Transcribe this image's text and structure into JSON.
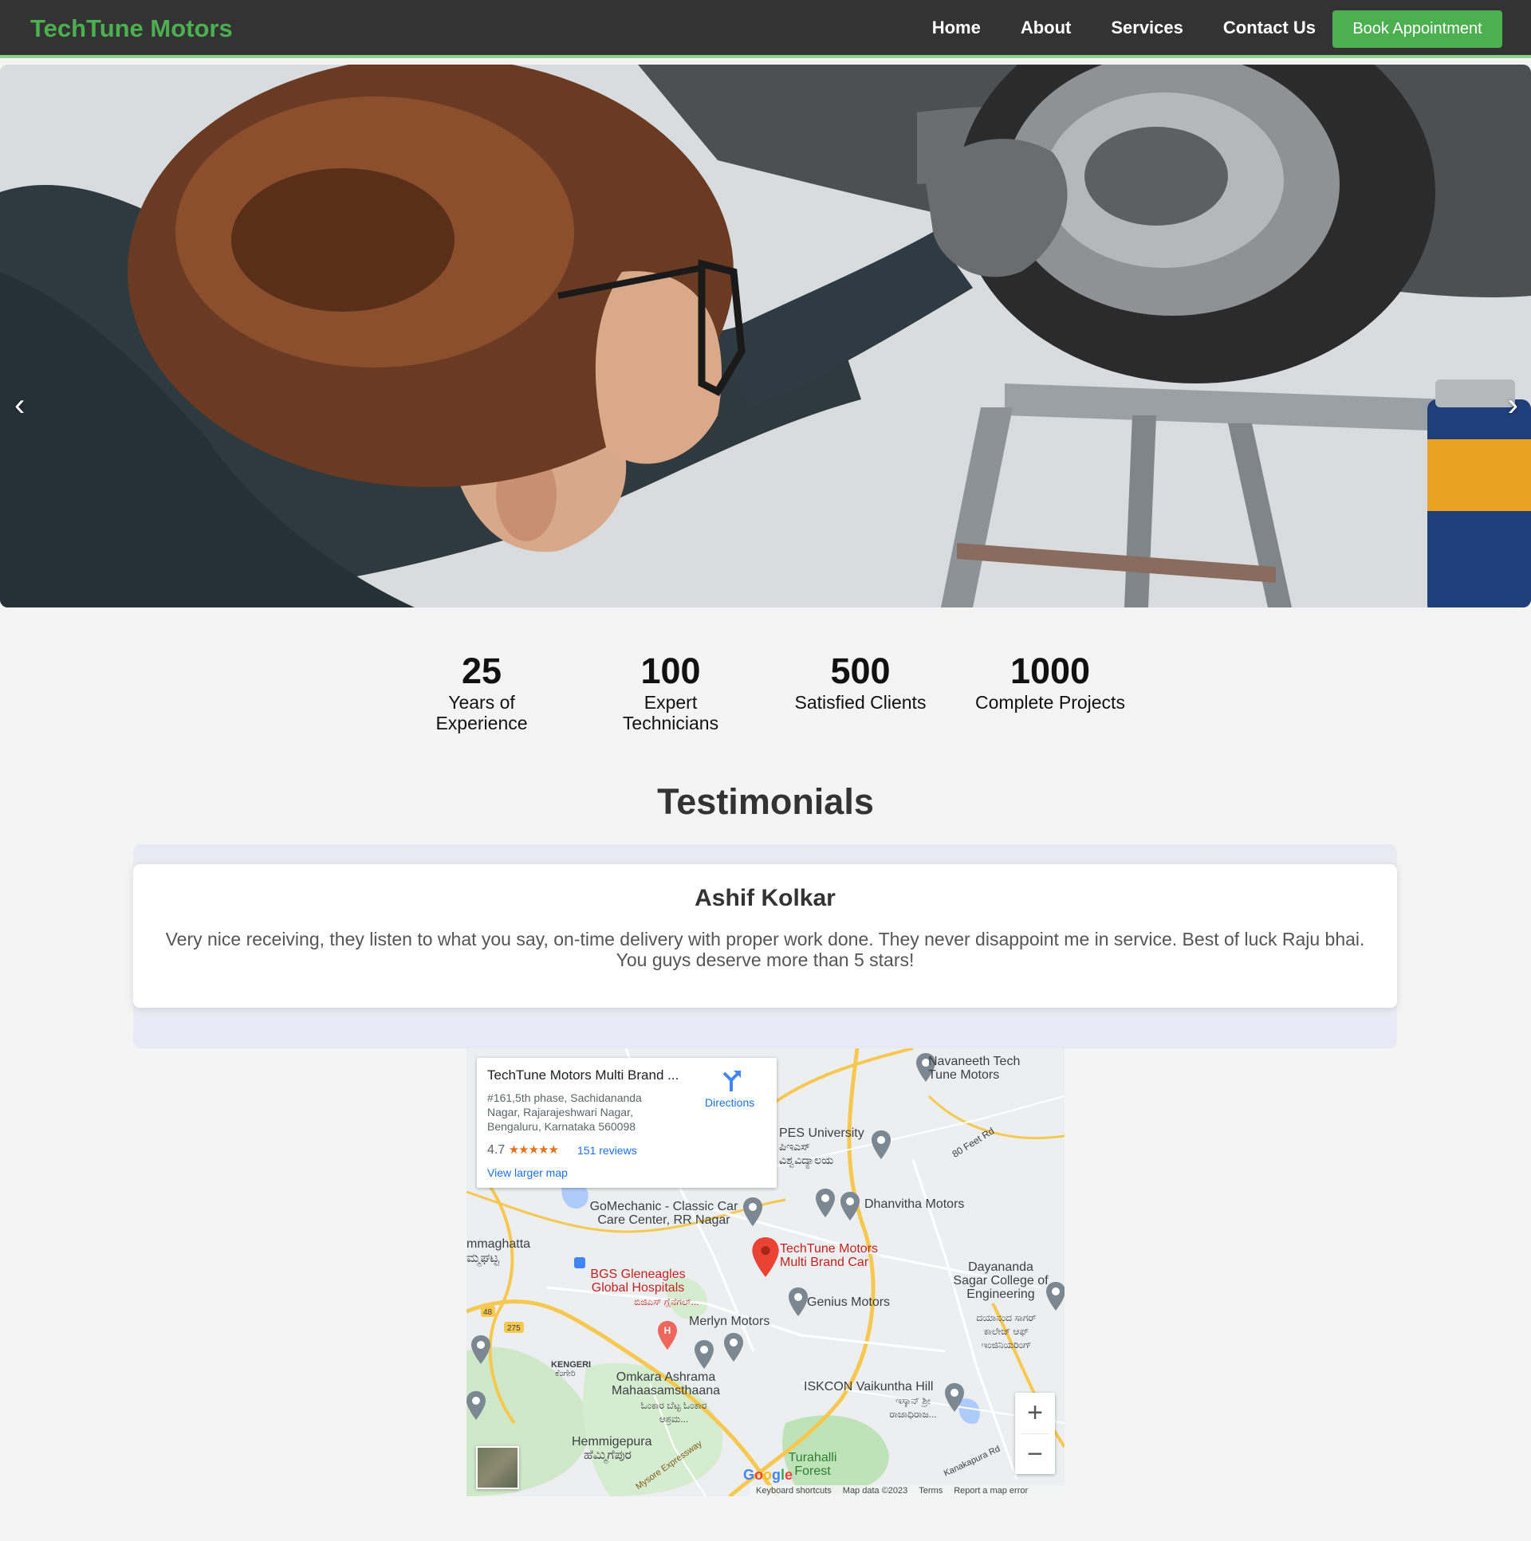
{
  "nav": {
    "brand": "TechTune Motors",
    "links": [
      "Home",
      "About",
      "Services",
      "Contact Us"
    ],
    "cta": "Book Appointment"
  },
  "hero": {
    "prev": "‹",
    "next": "›"
  },
  "stats": [
    {
      "number": "25",
      "label": "Years of Experience"
    },
    {
      "number": "100",
      "label": "Expert Technicians"
    },
    {
      "number": "500",
      "label": "Satisfied Clients"
    },
    {
      "number": "1000",
      "label": "Complete Projects"
    }
  ],
  "testimonials": {
    "title": "Testimonials",
    "name": "Ashif Kolkar",
    "text": "Very nice receiving, they listen to what you say, on-time delivery with proper work done. They never disappoint me in service. Best of luck Raju bhai. You guys deserve more than 5 stars!"
  },
  "map": {
    "info_title": "TechTune Motors Multi Brand ...",
    "info_address": "#161,5th phase, Sachidananda Nagar, Rajarajeshwari Nagar, Bengaluru, Karnataka 560098",
    "rating": "4.7",
    "stars": "★★★★★",
    "reviews": "151 reviews",
    "larger": "View larger map",
    "directions": "Directions",
    "labels": {
      "navaneeth": "Navaneeth Tech Tune Motors",
      "pes": "PES University",
      "pes_kn": "ಪಿಇಎಸ್ ವಿಶ್ವವಿದ್ಯಾಲಯ",
      "road80": "80 Feet Rd",
      "gomechanic": "GoMechanic - Classic Car Care Center, RR Nagar",
      "dhanvitha": "Dhanvitha Motors",
      "techtune": "TechTune Motors Multi Brand Car",
      "dayananda": "Dayananda Sagar College of Engineering",
      "dayananda_kn": "ದಯಾನಂದ ಸಾಗರ್ ಕಾಲೇಜ್ ಆಫ್ ಇಂಜಿನಿಯರಿಂಗ್",
      "bgs": "BGS Gleneagles Global Hospitals",
      "bgs_kn": "ಬಿಜಿಎಸ್ ಗ್ಲೆನೆಗಲ್...",
      "genius": "Genius Motors",
      "merlyn": "Merlyn Motors",
      "kengeri": "KENGERI",
      "kengeri_kn": "ಕೆಂಗೇರಿ",
      "omkara": "Omkara Ashrama Mahaasamsthaana",
      "omkara_kn": "ಓಂಕಾರ ಬೆಟ್ಟ ಓಂಕಾರ ಆಶ್ರಮ...",
      "iskcon": "ISKCON Vaikuntha Hill",
      "iskcon_kn": "ಇಸ್ಕಾನ್ ಶ್ರೀ ರಾಜಾಧಿರಾಜ...",
      "hemmigepura": "Hemmigepura",
      "hemmigepura_kn": "ಹೆಮ್ಮಿಗೆಪುರ",
      "mysore": "Mysore Expressway",
      "turahalli": "Turahalli Forest",
      "kanakapura": "Kanakapura Rd",
      "ummaghatta": "mmaghatta",
      "ummaghatta_kn": "ಮ್ಮಘಟ್ಟ",
      "rd48": "48",
      "rd275": "275"
    },
    "zoom_in": "+",
    "zoom_out": "−",
    "google": "Google",
    "footer": [
      "Keyboard shortcuts",
      "Map data ©2023",
      "Terms",
      "Report a map error"
    ]
  }
}
